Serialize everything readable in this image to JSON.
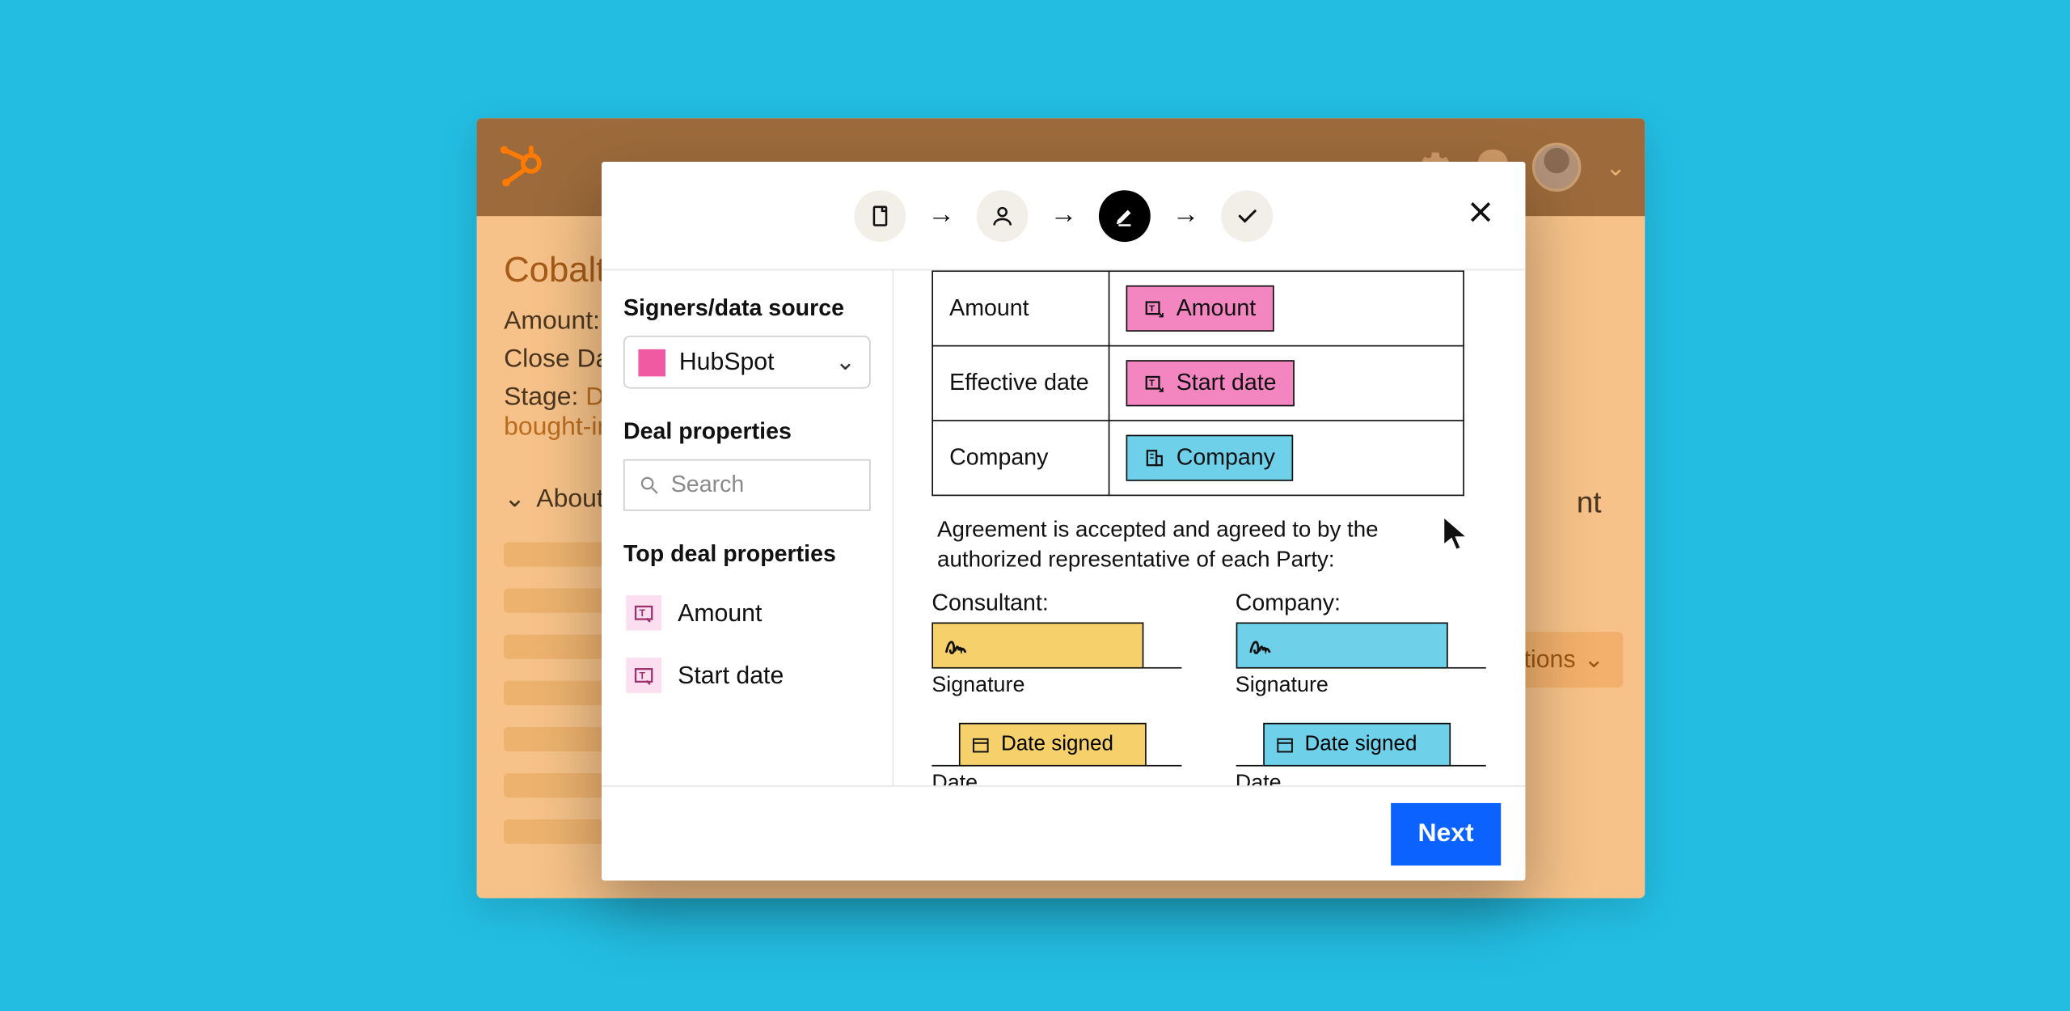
{
  "background": {
    "deal_title": "Cobalt Ci",
    "amount_label": "Amount: $",
    "close_date_label": "Close Date:",
    "stage_label": "Stage:",
    "stage_value_1": "Dec",
    "stage_value_2": "bought-in",
    "about_label": "About",
    "actions_label": "Actions",
    "right_fragment": "nt"
  },
  "modal": {
    "close_label": "Close",
    "steps": [
      "document",
      "person",
      "edit",
      "done"
    ],
    "active_step_index": 2,
    "sidebar": {
      "signers_label": "Signers/data source",
      "source_name": "HubSpot",
      "deal_props_label": "Deal properties",
      "search_placeholder": "Search",
      "top_props_label": "Top deal properties",
      "props": [
        {
          "label": "Amount"
        },
        {
          "label": "Start date"
        }
      ]
    },
    "doc": {
      "rows": [
        {
          "label": "Amount",
          "tag": "Amount",
          "color": "pink",
          "icon": "text-field-icon"
        },
        {
          "label": "Effective date",
          "tag": "Start date",
          "color": "pink",
          "icon": "text-field-icon"
        },
        {
          "label": "Company",
          "tag": "Company",
          "color": "blue",
          "icon": "company-icon"
        }
      ],
      "agreement_text": "Agreement is accepted and agreed to by the authorized representative of each Party:",
      "sig": {
        "left_heading": "Consultant:",
        "right_heading": "Company:",
        "signature_label": "Signature",
        "date_signed_label": "Date signed",
        "date_label": "Date"
      }
    },
    "next_label": "Next"
  },
  "colors": {
    "pink": "#f386c0",
    "blue": "#6fd0ea",
    "yellow": "#f5d06b",
    "accent": "#0b62ff"
  }
}
